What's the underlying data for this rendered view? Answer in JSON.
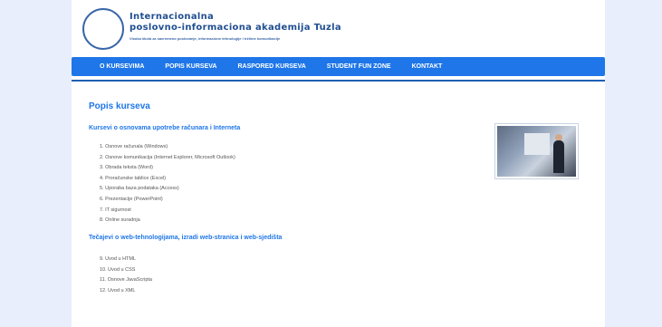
{
  "header": {
    "logo_line1": "Internacionalna",
    "logo_line2": "poslovno-informaciona akademija Tuzla",
    "logo_tagline": "Visoka škola za savremeno poslovanje, informacione tehnologije i tržišne komunikacije"
  },
  "nav": {
    "items": [
      "O KURSEVIMA",
      "POPIS KURSEVA",
      "RASPORED KURSEVA",
      "STUDENT FUN ZONE",
      "KONTAKT"
    ]
  },
  "content": {
    "title": "Popis kurseva",
    "section1": {
      "heading": "Kursevi o osnovama upotrebe računara i Interneta",
      "items": [
        "1. Osnove računala (Windows)",
        "2. Osnove komunikacija (Internet Explorer, Microsoft Outlook)",
        "3. Obrada teksta (Word)",
        "4. Proračunske tablice (Excel)",
        "5. Uporaba baza podataka (Access)",
        "6. Prezentacije (PowerPoint)",
        "7. IT sigurnost",
        "8. Online suradnja"
      ]
    },
    "section2": {
      "heading": "Tečajevi o web-tehnologijama, izradi web-stranica i web-sjedišta",
      "items": [
        "9. Uvod u HTML",
        "10. Uvod u CSS",
        "11. Osnove JavaScripta",
        "12. Uvod u XML"
      ]
    }
  },
  "colors": {
    "nav_bg": "#1e76e8",
    "heading": "#1e76e8",
    "page_bg": "#e8eefb"
  }
}
